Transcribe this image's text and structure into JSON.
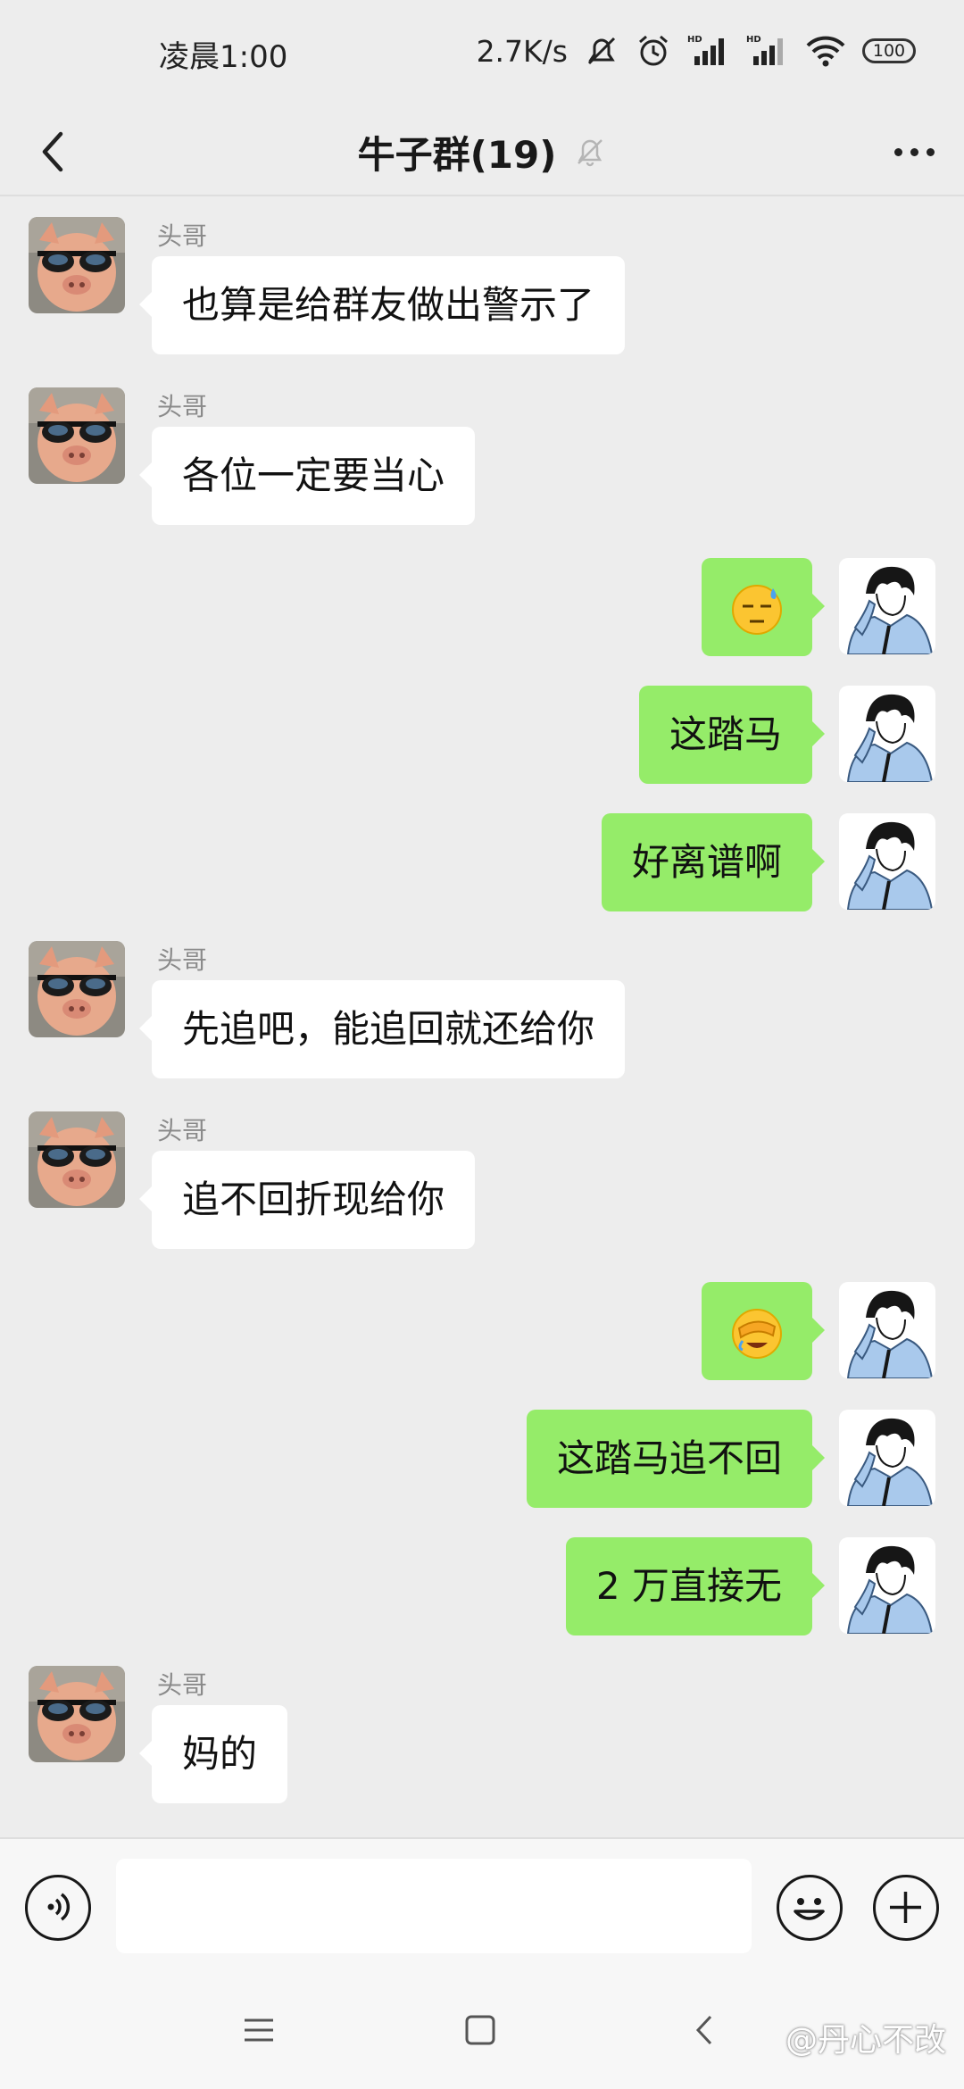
{
  "status_bar": {
    "time": "凌晨1:00",
    "net_speed": "2.7K/s",
    "battery": "100",
    "icons": [
      "mute-notification-icon",
      "alarm-icon",
      "hd-signal-icon",
      "hd-signal-icon",
      "wifi-icon",
      "battery-icon"
    ]
  },
  "header": {
    "title": "牛子群(19)",
    "back_icon": "chevron-left-icon",
    "muted_icon": "bell-muted-icon",
    "more_icon": "more-dots-icon"
  },
  "messages": [
    {
      "side": "in",
      "sender": "头哥",
      "text": "也算是给群友做出警示了"
    },
    {
      "side": "in",
      "sender": "头哥",
      "text": "各位一定要当心"
    },
    {
      "side": "out",
      "emoji": "sweat-unamused-emoji"
    },
    {
      "side": "out",
      "text": "这踏马"
    },
    {
      "side": "out",
      "text": "好离谱啊"
    },
    {
      "side": "in",
      "sender": "头哥",
      "text": "先追吧，能追回就还给你"
    },
    {
      "side": "in",
      "sender": "头哥",
      "text": "追不回折现给你"
    },
    {
      "side": "out",
      "emoji": "facepalm-laugh-emoji"
    },
    {
      "side": "out",
      "text": "这踏马追不回"
    },
    {
      "side": "out",
      "text": "2 万直接无"
    },
    {
      "side": "in",
      "sender": "头哥",
      "text": "妈的"
    }
  ],
  "input_bar": {
    "voice_icon": "voice-icon",
    "input_value": "",
    "emoji_icon": "smiley-icon",
    "add_icon": "plus-icon"
  },
  "nav_bar": {
    "icons": [
      "menu-icon",
      "home-square-icon",
      "back-arrow-icon"
    ]
  },
  "watermark": "@丹心不改",
  "colors": {
    "background": "#ededed",
    "incoming_bubble": "#ffffff",
    "outgoing_bubble": "#95ec69"
  }
}
